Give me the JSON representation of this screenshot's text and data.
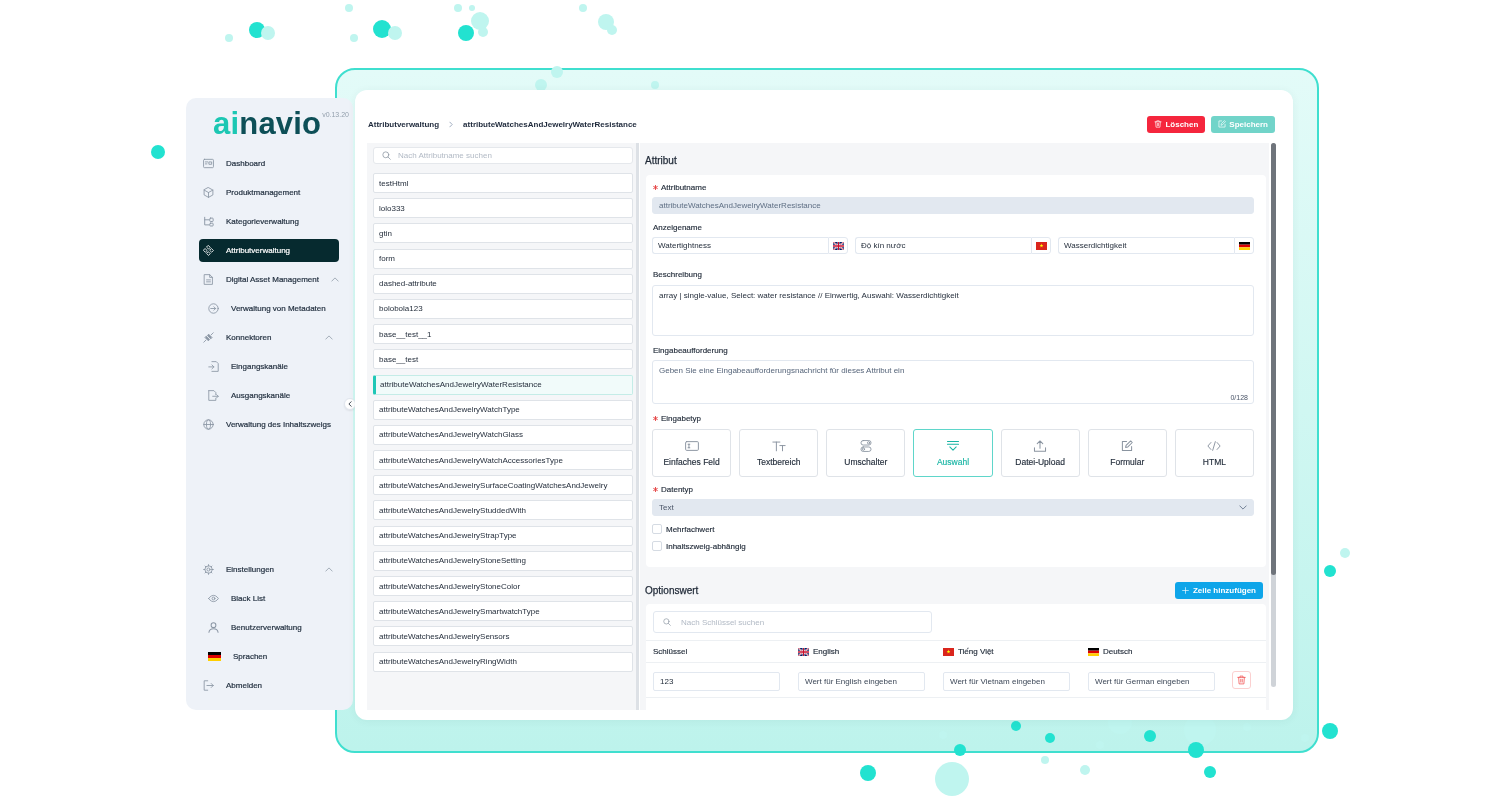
{
  "sidebar": {
    "logo": {
      "accent": "ai",
      "name": "navio"
    },
    "version": "v0.13.20",
    "items": [
      {
        "label": "Dashboard",
        "selected": false
      },
      {
        "label": "Produktmanagement",
        "selected": false
      },
      {
        "label": "Kategorieverwaltung",
        "selected": false
      },
      {
        "label": "Attributverwaltung",
        "selected": true
      },
      {
        "label": "Digital Asset Management",
        "selected": false,
        "expanded": true,
        "children": [
          {
            "label": "Verwaltung von Metadaten",
            "selected": false
          }
        ]
      },
      {
        "label": "Konnektoren",
        "selected": false,
        "expanded": true,
        "children": [
          {
            "label": "Eingangskanäle",
            "selected": false
          },
          {
            "label": "Ausgangskanäle",
            "selected": false
          }
        ]
      },
      {
        "label": "Verwaltung des Inhaltszweigs",
        "selected": false
      }
    ],
    "bottom_items": [
      {
        "label": "Einstellungen",
        "selected": false,
        "expanded": true,
        "children": [
          {
            "label": "Black List",
            "selected": false
          },
          {
            "label": "Benutzerverwaltung",
            "selected": false
          },
          {
            "label": "Sprachen",
            "selected": false
          }
        ]
      },
      {
        "label": "Abmelden",
        "selected": false
      }
    ]
  },
  "breadcrumb": [
    "Attributverwaltung",
    "attributeWatchesAndJewelryWaterResistance"
  ],
  "actions": [
    {
      "label": "Löschen",
      "kind": "danger",
      "disabled": false
    },
    {
      "label": "Speichern",
      "kind": "primary",
      "disabled": true
    }
  ],
  "attribute_list": {
    "search": {
      "placeholder": "Nach Attributname suchen"
    },
    "items": [
      {
        "name": "testHtml",
        "selected": false
      },
      {
        "name": "lolo333",
        "selected": false
      },
      {
        "name": "gtin",
        "selected": false
      },
      {
        "name": "form",
        "selected": false
      },
      {
        "name": "dashed-attribute",
        "selected": false
      },
      {
        "name": "bolobola123",
        "selected": false
      },
      {
        "name": "base__test__1",
        "selected": false
      },
      {
        "name": "base__test",
        "selected": false
      },
      {
        "name": "attributeWatchesAndJewelryWaterResistance",
        "selected": true
      },
      {
        "name": "attributeWatchesAndJewelryWatchType",
        "selected": false
      },
      {
        "name": "attributeWatchesAndJewelryWatchGlass",
        "selected": false
      },
      {
        "name": "attributeWatchesAndJewelryWatchAccessoriesType",
        "selected": false
      },
      {
        "name": "attributeWatchesAndJewelrySurfaceCoatingWatchesAndJewelry",
        "selected": false
      },
      {
        "name": "attributeWatchesAndJewelryStuddedWith",
        "selected": false
      },
      {
        "name": "attributeWatchesAndJewelryStrapType",
        "selected": false
      },
      {
        "name": "attributeWatchesAndJewelryStoneSetting",
        "selected": false
      },
      {
        "name": "attributeWatchesAndJewelryStoneColor",
        "selected": false
      },
      {
        "name": "attributeWatchesAndJewelrySmartwatchType",
        "selected": false
      },
      {
        "name": "attributeWatchesAndJewelrySensors",
        "selected": false
      },
      {
        "name": "attributeWatchesAndJewelryRingWidth",
        "selected": false
      }
    ]
  },
  "attribute": {
    "title": "Attribut",
    "name": {
      "label": "Attributname",
      "required": true,
      "value": "attributeWatchesAndJewelryWaterResistance",
      "disabled": true
    },
    "display_name": {
      "label": "Anzeigename",
      "required": false,
      "values": [
        {
          "value": "Watertightness"
        },
        {
          "value": "Độ kín nước"
        },
        {
          "value": "Wasserdichtigkeit"
        }
      ]
    },
    "description": {
      "label": "Beschreibung",
      "required": false,
      "value": "array | single-value, Select: water resistance // Einwertig, Auswahl: Wasserdichtigkeit"
    },
    "prompt": {
      "label": "Eingabeaufforderung",
      "required": false,
      "placeholder": "Geben Sie eine Eingabeaufforderungsnachricht für dieses Attribut ein",
      "counter": "0/128"
    },
    "input_type": {
      "label": "Eingabetyp",
      "required": true,
      "options": [
        {
          "label": "Einfaches Feld",
          "selected": false
        },
        {
          "label": "Textbereich",
          "selected": false
        },
        {
          "label": "Umschalter",
          "selected": false
        },
        {
          "label": "Auswahl",
          "selected": true
        },
        {
          "label": "Datei-Upload",
          "selected": false
        },
        {
          "label": "Formular",
          "selected": false
        },
        {
          "label": "HTML",
          "selected": false
        }
      ]
    },
    "data_type": {
      "label": "Datentyp",
      "required": true,
      "value": "Text",
      "disabled": true
    },
    "checkboxes": [
      {
        "label": "Mehrfachwert",
        "checked": false
      },
      {
        "label": "Inhaltszweig-abhängig",
        "checked": false
      }
    ]
  },
  "option_values": {
    "title": "Optionswert",
    "add_button": "Zeile hinzufügen",
    "search": {
      "placeholder": "Nach Schlüssel suchen"
    },
    "columns": [
      {
        "label": "Schlüssel"
      },
      {
        "label": "English"
      },
      {
        "label": "Tiếng Việt"
      },
      {
        "label": "Deutsch"
      }
    ],
    "rows": [
      {
        "key": "123",
        "values": [
          {
            "placeholder": "Wert für English eingeben"
          },
          {
            "placeholder": "Wert für Vietnam eingeben"
          },
          {
            "placeholder": "Wert für German eingeben"
          }
        ]
      }
    ]
  }
}
